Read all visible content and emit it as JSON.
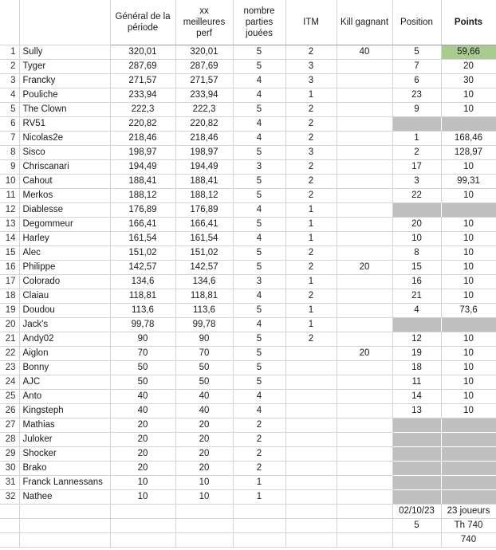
{
  "table": {
    "columns": [
      {
        "key": "idx",
        "label": ""
      },
      {
        "key": "name",
        "label": ""
      },
      {
        "key": "gen",
        "label": "Général de la période"
      },
      {
        "key": "perf",
        "label": "xx meilleures perf"
      },
      {
        "key": "parts",
        "label": "nombre parties jouées"
      },
      {
        "key": "itm",
        "label": "ITM"
      },
      {
        "key": "kill",
        "label": "Kill gagnant"
      },
      {
        "key": "pos",
        "label": "Position"
      },
      {
        "key": "pts",
        "label": "Points"
      }
    ],
    "rows": [
      {
        "idx": "1",
        "name": "Sully",
        "gen": "320,01",
        "perf": "320,01",
        "parts": "5",
        "itm": "2",
        "kill": "40",
        "pos": "5",
        "pts": "59,66",
        "pts_green": true
      },
      {
        "idx": "2",
        "name": "Tyger",
        "gen": "287,69",
        "perf": "287,69",
        "parts": "5",
        "itm": "3",
        "kill": "",
        "pos": "7",
        "pts": "20"
      },
      {
        "idx": "3",
        "name": "Francky",
        "gen": "271,57",
        "perf": "271,57",
        "parts": "4",
        "itm": "3",
        "kill": "",
        "pos": "6",
        "pts": "30"
      },
      {
        "idx": "4",
        "name": "Pouliche",
        "gen": "233,94",
        "perf": "233,94",
        "parts": "4",
        "itm": "1",
        "kill": "",
        "pos": "23",
        "pts": "10"
      },
      {
        "idx": "5",
        "name": "The Clown",
        "gen": "222,3",
        "perf": "222,3",
        "parts": "5",
        "itm": "2",
        "kill": "",
        "pos": "9",
        "pts": "10"
      },
      {
        "idx": "6",
        "name": "RV51",
        "gen": "220,82",
        "perf": "220,82",
        "parts": "4",
        "itm": "2",
        "kill": "",
        "pos": "",
        "pts": "",
        "shaded": true
      },
      {
        "idx": "7",
        "name": "Nicolas2e",
        "gen": "218,46",
        "perf": "218,46",
        "parts": "4",
        "itm": "2",
        "kill": "",
        "pos": "1",
        "pts": "168,46"
      },
      {
        "idx": "8",
        "name": "Sisco",
        "gen": "198,97",
        "perf": "198,97",
        "parts": "5",
        "itm": "3",
        "kill": "",
        "pos": "2",
        "pts": "128,97"
      },
      {
        "idx": "9",
        "name": "Chriscanari",
        "gen": "194,49",
        "perf": "194,49",
        "parts": "3",
        "itm": "2",
        "kill": "",
        "pos": "17",
        "pts": "10"
      },
      {
        "idx": "10",
        "name": "Cahout",
        "gen": "188,41",
        "perf": "188,41",
        "parts": "5",
        "itm": "2",
        "kill": "",
        "pos": "3",
        "pts": "99,31"
      },
      {
        "idx": "11",
        "name": "Merkos",
        "gen": "188,12",
        "perf": "188,12",
        "parts": "5",
        "itm": "2",
        "kill": "",
        "pos": "22",
        "pts": "10"
      },
      {
        "idx": "12",
        "name": "Diablesse",
        "gen": "176,89",
        "perf": "176,89",
        "parts": "4",
        "itm": "1",
        "kill": "",
        "pos": "",
        "pts": "",
        "shaded": true
      },
      {
        "idx": "13",
        "name": "Degommeur",
        "gen": "166,41",
        "perf": "166,41",
        "parts": "5",
        "itm": "1",
        "kill": "",
        "pos": "20",
        "pts": "10"
      },
      {
        "idx": "14",
        "name": "Harley",
        "gen": "161,54",
        "perf": "161,54",
        "parts": "4",
        "itm": "1",
        "kill": "",
        "pos": "10",
        "pts": "10"
      },
      {
        "idx": "15",
        "name": "Alec",
        "gen": "151,02",
        "perf": "151,02",
        "parts": "5",
        "itm": "2",
        "kill": "",
        "pos": "8",
        "pts": "10"
      },
      {
        "idx": "16",
        "name": "Philippe",
        "gen": "142,57",
        "perf": "142,57",
        "parts": "5",
        "itm": "2",
        "kill": "20",
        "pos": "15",
        "pts": "10"
      },
      {
        "idx": "17",
        "name": "Colorado",
        "gen": "134,6",
        "perf": "134,6",
        "parts": "3",
        "itm": "1",
        "kill": "",
        "pos": "16",
        "pts": "10"
      },
      {
        "idx": "18",
        "name": "Claiau",
        "gen": "118,81",
        "perf": "118,81",
        "parts": "4",
        "itm": "2",
        "kill": "",
        "pos": "21",
        "pts": "10"
      },
      {
        "idx": "19",
        "name": "Doudou",
        "gen": "113,6",
        "perf": "113,6",
        "parts": "5",
        "itm": "1",
        "kill": "",
        "pos": "4",
        "pts": "73,6"
      },
      {
        "idx": "20",
        "name": "Jack's",
        "gen": "99,78",
        "perf": "99,78",
        "parts": "4",
        "itm": "1",
        "kill": "",
        "pos": "",
        "pts": "",
        "shaded": true
      },
      {
        "idx": "21",
        "name": "Andy02",
        "gen": "90",
        "perf": "90",
        "parts": "5",
        "itm": "2",
        "kill": "",
        "pos": "12",
        "pts": "10"
      },
      {
        "idx": "22",
        "name": "Aiglon",
        "gen": "70",
        "perf": "70",
        "parts": "5",
        "itm": "",
        "kill": "20",
        "pos": "19",
        "pts": "10"
      },
      {
        "idx": "23",
        "name": "Bonny",
        "gen": "50",
        "perf": "50",
        "parts": "5",
        "itm": "",
        "kill": "",
        "pos": "18",
        "pts": "10"
      },
      {
        "idx": "24",
        "name": "AJC",
        "gen": "50",
        "perf": "50",
        "parts": "5",
        "itm": "",
        "kill": "",
        "pos": "11",
        "pts": "10"
      },
      {
        "idx": "25",
        "name": "Anto",
        "gen": "40",
        "perf": "40",
        "parts": "4",
        "itm": "",
        "kill": "",
        "pos": "14",
        "pts": "10"
      },
      {
        "idx": "26",
        "name": "Kingsteph",
        "gen": "40",
        "perf": "40",
        "parts": "4",
        "itm": "",
        "kill": "",
        "pos": "13",
        "pts": "10"
      },
      {
        "idx": "27",
        "name": "Mathias",
        "gen": "20",
        "perf": "20",
        "parts": "2",
        "itm": "",
        "kill": "",
        "pos": "",
        "pts": "",
        "shaded": true,
        "block_top": true
      },
      {
        "idx": "28",
        "name": "Juloker",
        "gen": "20",
        "perf": "20",
        "parts": "2",
        "itm": "",
        "kill": "",
        "pos": "",
        "pts": "",
        "shaded": true,
        "block_mid": true
      },
      {
        "idx": "29",
        "name": "Shocker",
        "gen": "20",
        "perf": "20",
        "parts": "2",
        "itm": "",
        "kill": "",
        "pos": "",
        "pts": "",
        "shaded": true,
        "block_mid": true
      },
      {
        "idx": "30",
        "name": "Brako",
        "gen": "20",
        "perf": "20",
        "parts": "2",
        "itm": "",
        "kill": "",
        "pos": "",
        "pts": "",
        "shaded": true,
        "block_mid": true
      },
      {
        "idx": "31",
        "name": "Franck Lannessans",
        "gen": "10",
        "perf": "10",
        "parts": "1",
        "itm": "",
        "kill": "",
        "pos": "",
        "pts": "",
        "shaded": true,
        "block_mid": true
      },
      {
        "idx": "32",
        "name": "Nathee",
        "gen": "10",
        "perf": "10",
        "parts": "1",
        "itm": "",
        "kill": "",
        "pos": "",
        "pts": "",
        "shaded": true,
        "block_mid": true
      }
    ],
    "footer_rows": [
      {
        "idx": "",
        "name": "",
        "gen": "",
        "perf": "",
        "parts": "",
        "itm": "",
        "kill": "",
        "pos": "02/10/23",
        "pts": "23 joueurs",
        "bold_pts": true
      },
      {
        "idx": "",
        "name": "",
        "gen": "",
        "perf": "",
        "parts": "",
        "itm": "",
        "kill": "",
        "pos": "5",
        "pts": "Th 740",
        "bold_pts": true
      },
      {
        "idx": "",
        "name": "",
        "gen": "",
        "perf": "",
        "parts": "",
        "itm": "",
        "kill": "",
        "pos": "",
        "pts": "740",
        "bold_pts": true
      }
    ]
  },
  "colors": {
    "highlight_green": "#a9cb8f",
    "shaded_grey": "#bfbfbf",
    "gridline": "#d4d4d4",
    "heavy_border": "#8a8a8a"
  }
}
